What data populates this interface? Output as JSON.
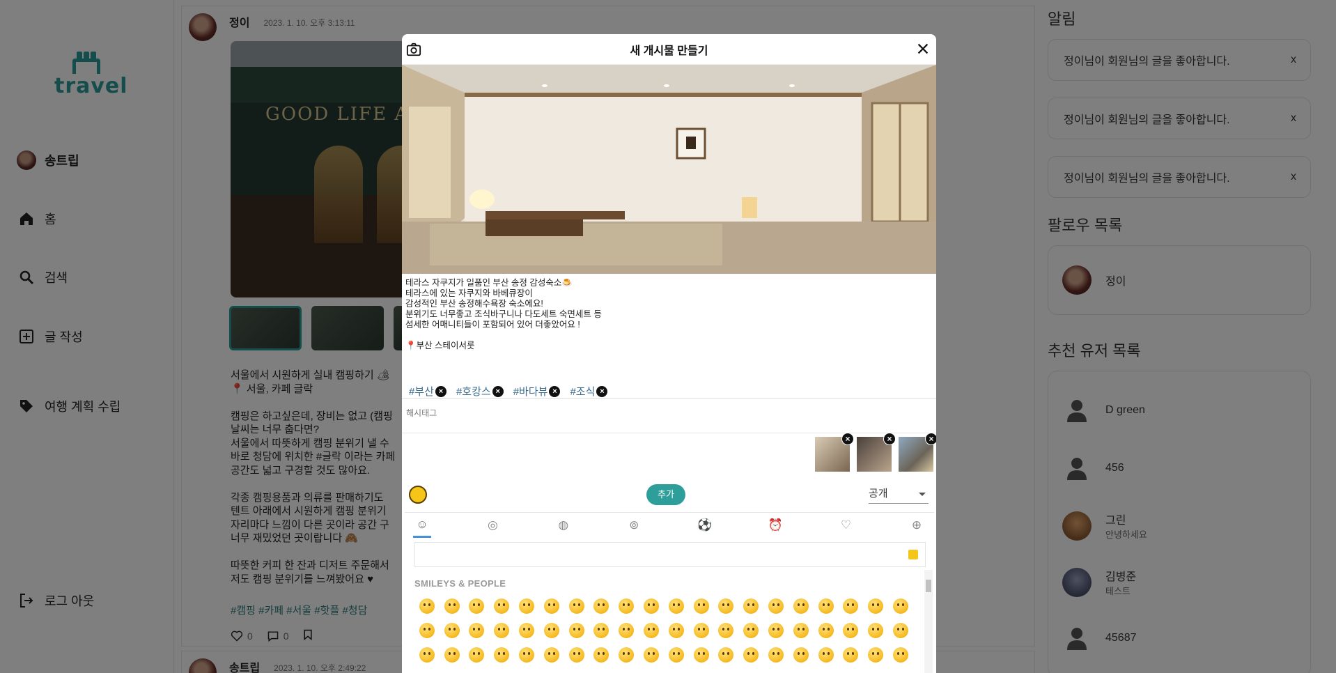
{
  "brand": {
    "logo_text": "travel"
  },
  "sidebar": {
    "user_name": "송트립",
    "items": [
      {
        "label": "홈",
        "icon": "home-icon"
      },
      {
        "label": "검색",
        "icon": "search-icon"
      },
      {
        "label": "글 작성",
        "icon": "plus-square-icon"
      },
      {
        "label": "여행 계획 수립",
        "icon": "tag-icon"
      },
      {
        "label": "로그 아웃",
        "icon": "logout-icon"
      }
    ]
  },
  "feed": {
    "post1": {
      "author": "정이",
      "time": "2023. 1. 10. 오후 3:13:11",
      "image_sign": "GOOD LIFE AI",
      "text": "서울에서 시원하게 실내 캠핑하기 🏕\n📍 서울, 카페 글락\n\n캠핑은 하고싶은데, 장비는 없고 (캠핑\n날씨는 너무 춥다면?\n서울에서 따뜻하게 캠핑 분위기 낼 수\n바로 청담에 위치한 #글락 이라는 카페\n공간도 넓고 구경할 것도 많아요.\n\n각종 캠핑용품과 의류를 판매하기도 \n텐트 아래에서 시원하게 캠핑 분위기\n자리마다 느낌이 다른 곳이라 공간 구\n너무 재밌었던 곳이랍니다 🙈\n\n따뜻한 커피 한 잔과 디저트 주문해서\n저도 캠핑 분위기를 느껴봤어요 ♥",
      "tags": "#캠핑 #카페 #서울 #핫플 #청담",
      "likes": "0",
      "comments": "0"
    },
    "post2": {
      "author": "송트립",
      "time": "2023. 1. 10. 오후 2:49:22"
    }
  },
  "right": {
    "notifications_title": "알림",
    "notifications": [
      {
        "text": "정이님이 회원님의 글을 좋아합니다.",
        "close": "x"
      },
      {
        "text": "정이님이 회원님의 글을 좋아합니다.",
        "close": "x"
      },
      {
        "text": "정이님이 회원님의 글을 좋아합니다.",
        "close": "x"
      }
    ],
    "follow_title": "팔로우 목록",
    "follows": [
      {
        "name": "정이"
      }
    ],
    "recommend_title": "추천 유저 목록",
    "recommends": [
      {
        "name": "D green",
        "sub": ""
      },
      {
        "name": "456",
        "sub": ""
      },
      {
        "name": "그린",
        "sub": "안녕하세요"
      },
      {
        "name": "김병준",
        "sub": "테스트"
      },
      {
        "name": "45687",
        "sub": ""
      }
    ]
  },
  "modal": {
    "title": "새 개시물 만들기",
    "body_text": "테라스 자쿠지가 일품인 부산 송정 감성숙소🍮\n테라스에 있는 자쿠지와 바베큐장이\n감성적인 부산 송정해수욕장 숙소에요!\n분위기도 너무좋고 조식바구니나 다도세트 숙면세트 등\n섬세한 어매니티들이 포함되어 있어 더좋았어요 !\n\n📍부산 스테이서룻",
    "hashtags": [
      "#부산",
      "#호캉스",
      "#바다뷰",
      "#조식"
    ],
    "hashtag_placeholder": "해시태그",
    "add_label": "추가",
    "visibility": "공개",
    "emoji_section_label": "SMILEYS & PEOPLE",
    "emoji_categories": [
      "smileys-icon",
      "animals-icon",
      "food-icon",
      "travel-icon",
      "activity-icon",
      "objects-icon",
      "symbols-icon",
      "flags-icon"
    ]
  },
  "colors": {
    "accent": "#2e9e9a",
    "tag": "#3a6e8f",
    "overlay": "rgba(0,0,0,0.5)"
  }
}
